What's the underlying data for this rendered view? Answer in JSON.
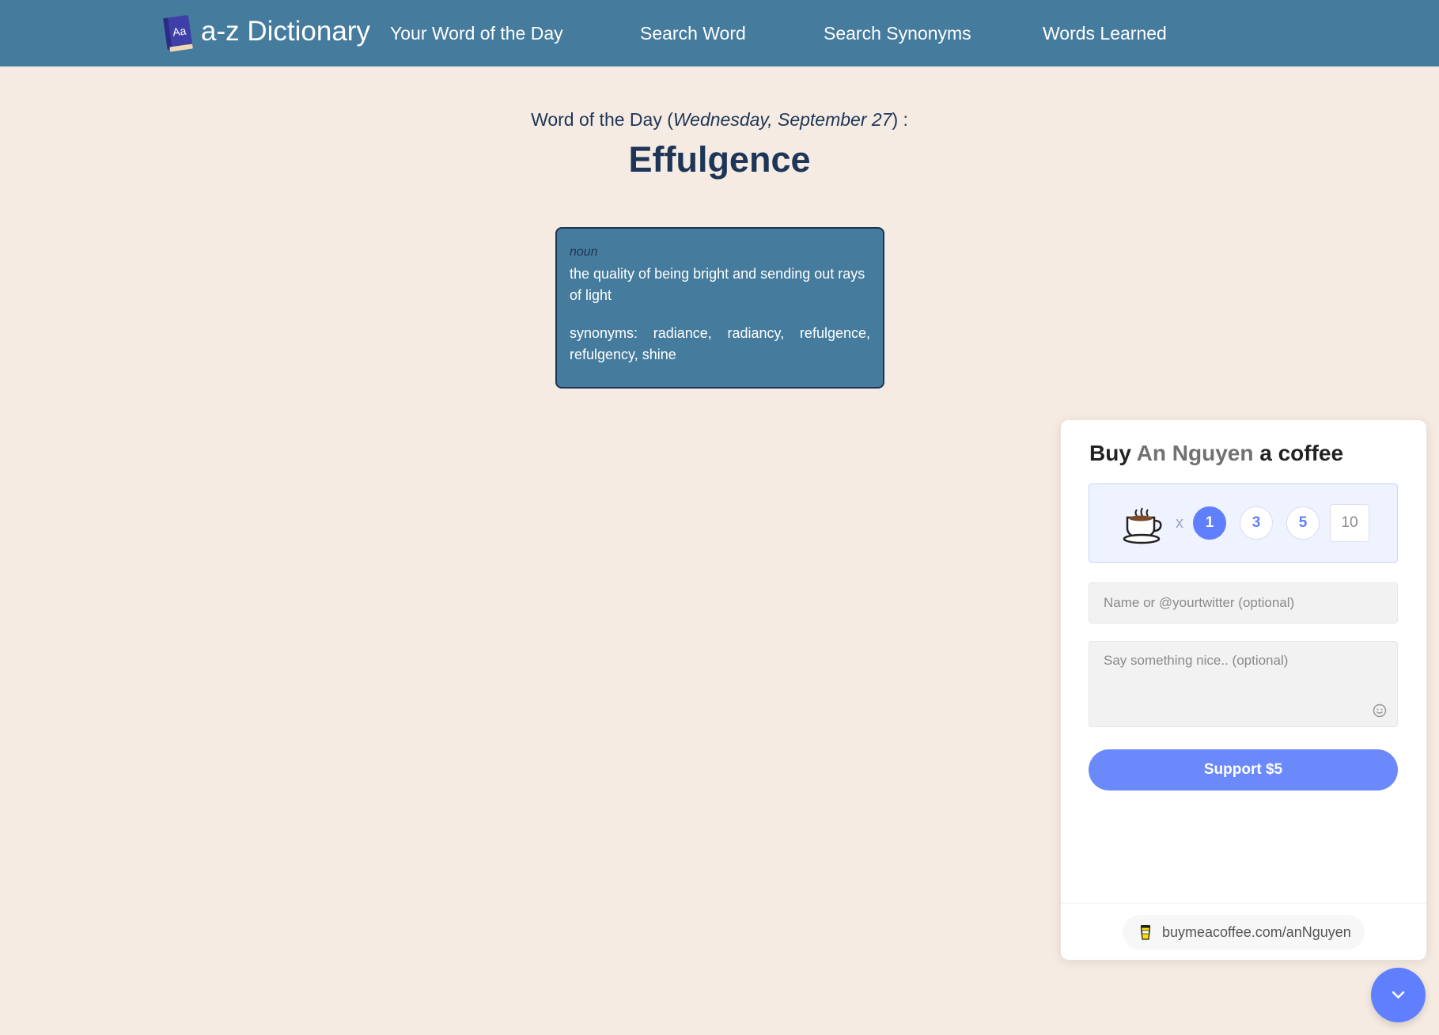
{
  "navbar": {
    "brand": "a-z Dictionary",
    "logo_icon": "dictionary-book-icon",
    "logo_text": "Aa",
    "links": [
      "Your Word of the Day",
      "Search Word",
      "Search Synonyms",
      "Words Learned"
    ]
  },
  "main": {
    "heading_prefix": "Word of the Day (",
    "date": "Wednesday, September 27",
    "heading_suffix": ") :",
    "word": "Effulgence",
    "definition_card": {
      "part_of_speech": "noun",
      "definition": "the quality of being bright and sending out rays of light",
      "synonyms_text": "synonyms: radiance, radiancy, refulgence, refulgency, shine"
    }
  },
  "bmc": {
    "title_prefix": "Buy",
    "creator": "An Nguyen",
    "title_suffix": "a coffee",
    "cup_icon": "coffee-cup-icon",
    "multiplier": "x",
    "quantity_options": [
      "1",
      "3",
      "5"
    ],
    "selected_quantity": "1",
    "custom_quantity_placeholder": "10",
    "name_placeholder": "Name or @yourtwitter (optional)",
    "message_placeholder": "Say something nice.. (optional)",
    "emoji_icon": "smiley-icon",
    "support_label": "Support $5",
    "footer_link": "buymeacoffee.com/anNguyen",
    "collapse_icon": "chevron-down-icon"
  },
  "colors": {
    "navbar_bg": "#457b9d",
    "page_bg": "#f5ebe2",
    "text_dark": "#1d3557",
    "bmc_accent": "#5f7fff",
    "support_button": "#6c89fb"
  }
}
